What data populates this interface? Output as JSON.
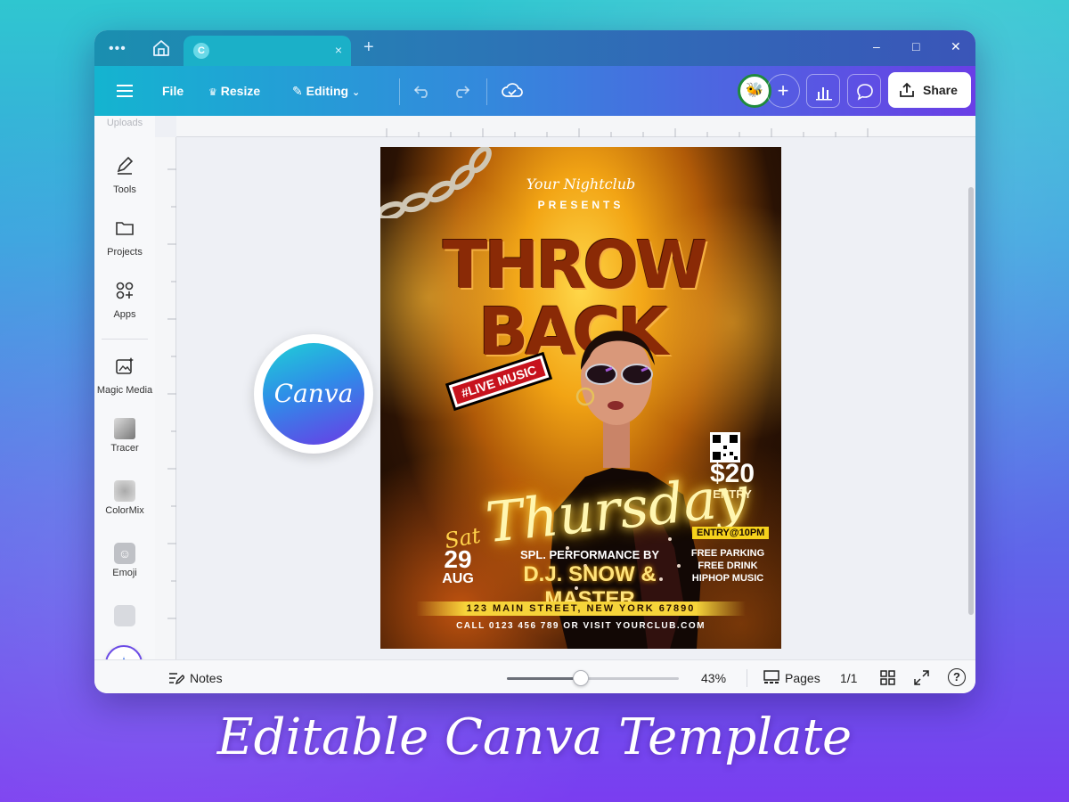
{
  "app": {
    "colors": {
      "accent": "#6b3ae6",
      "teal": "#14b4d0",
      "avatar_ring": "#1f8a3c"
    }
  },
  "titlebar": {
    "menu_dots": "•••",
    "tab_logo_icon": "canva-logo-icon",
    "tab_close": "×",
    "new_tab": "+",
    "window_controls": {
      "minimize": "–",
      "maximize": "□",
      "close": "✕"
    }
  },
  "toolbar": {
    "menu_icon": "hamburger-icon",
    "file_label": "File",
    "resize_label": "Resize",
    "editing_label": "Editing",
    "add_label": "+",
    "share_label": "Share"
  },
  "sidebar": {
    "items": [
      {
        "label": "Uploads",
        "icon": "upload-icon"
      },
      {
        "label": "Tools",
        "icon": "pen-icon"
      },
      {
        "label": "Projects",
        "icon": "folder-icon"
      },
      {
        "label": "Apps",
        "icon": "apps-grid-icon"
      },
      {
        "label": "Magic Media",
        "icon": "magic-media-icon"
      },
      {
        "label": "Tracer",
        "icon": "tracer-icon"
      },
      {
        "label": "ColorMix",
        "icon": "colormix-icon"
      },
      {
        "label": "Emoji",
        "icon": "emoji-icon"
      }
    ],
    "magic_icon": "✦"
  },
  "flyer": {
    "script_top": "Your Nightclub",
    "presents": "PRESENTS",
    "title_1": "THROW",
    "title_2": "BACK",
    "live_badge": "#LIVE MUSIC",
    "price": "$20",
    "entry": "ENTRY",
    "day_script": "Thursday",
    "weekday": "Sat",
    "day_num": "29",
    "month": "AUG",
    "spl_performance": "SPL. PERFORMANCE BY",
    "performers": "D.J. SNOW & MASTER",
    "entry_time": "ENTRY@10PM",
    "perk_1": "FREE PARKING",
    "perk_2": "FREE DRINK",
    "perk_3": "HIPHOP MUSIC",
    "address": "123 MAIN STREET, NEW YORK 67890",
    "call": "CALL 0123 456 789 OR VISIT YOURCLUB.COM"
  },
  "canva_badge": {
    "text": "Canva"
  },
  "bottombar": {
    "notes_label": "Notes",
    "zoom_value": 43,
    "zoom_label": "43%",
    "pages_label": "Pages",
    "page_count": "1/1",
    "help_label": "?"
  },
  "banner": {
    "text": "Editable Canva Template"
  }
}
